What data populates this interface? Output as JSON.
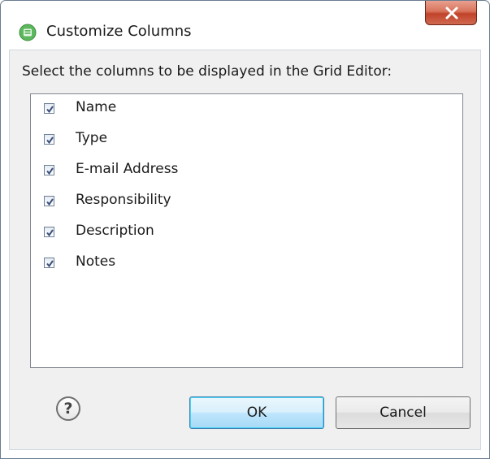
{
  "window": {
    "title": "Customize Columns",
    "icon": "app-icon"
  },
  "dialog": {
    "instruction": "Select the columns to be displayed in the Grid Editor:",
    "columns": [
      {
        "label": "Name",
        "checked": true
      },
      {
        "label": "Type",
        "checked": true
      },
      {
        "label": "E-mail Address",
        "checked": true
      },
      {
        "label": "Responsibility",
        "checked": true
      },
      {
        "label": "Description",
        "checked": true
      },
      {
        "label": "Notes",
        "checked": true
      }
    ]
  },
  "buttons": {
    "help": "?",
    "ok": "OK",
    "cancel": "Cancel"
  },
  "colors": {
    "close_button": "#c0432a",
    "default_button_border": "#3c7fb1",
    "app_icon": "#5cb85c"
  }
}
